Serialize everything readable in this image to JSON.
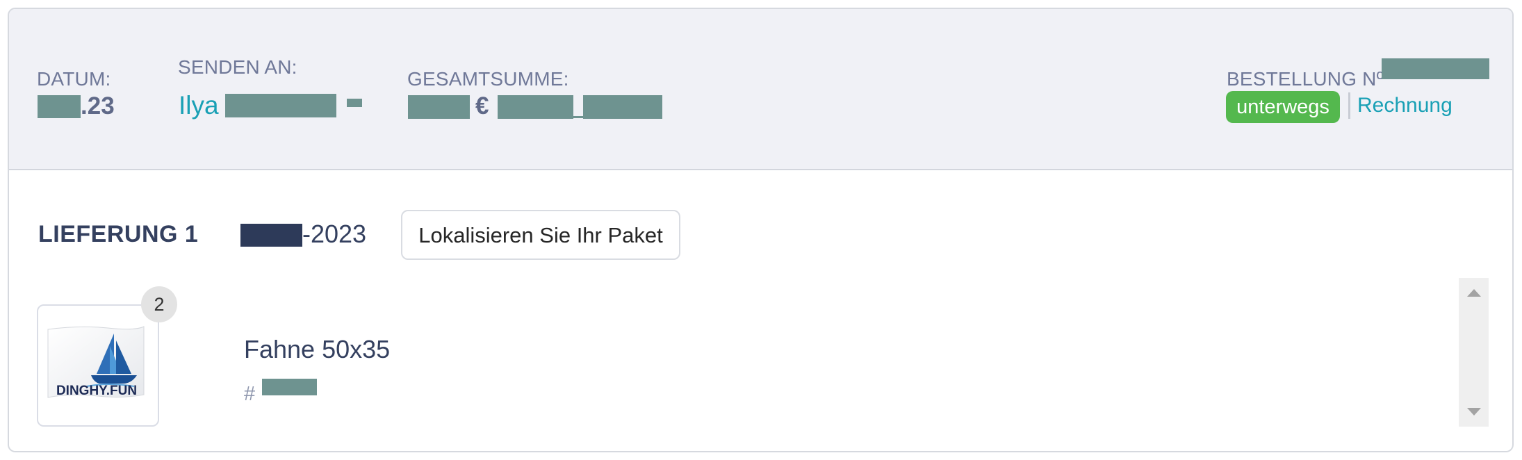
{
  "order_header": {
    "date_label": "DATUM:",
    "date_suffix": ".23",
    "ship_to_label": "SENDEN AN:",
    "ship_to_name": "Ilya",
    "total_label": "GESAMTSUMME:",
    "currency_symbol": "€",
    "order_number_label": "BESTELLUNG Nº",
    "status_badge": "unterwegs",
    "invoice_link": "Rechnung",
    "colors": {
      "status_green": "#54b84e",
      "link_teal": "#19a0b5",
      "redaction": "#6e9390"
    }
  },
  "shipment": {
    "title": "LIEFERUNG 1",
    "date_suffix": "-2023",
    "track_button": "Lokalisieren Sie Ihr Paket",
    "items": [
      {
        "quantity": "2",
        "name": "Fahne 50x35",
        "sku_prefix": "#",
        "image_logo_text": "DINGHY.FUN"
      }
    ]
  },
  "icons": [
    "sailboat-logo-icon",
    "scroll-up-icon",
    "scroll-down-icon"
  ]
}
